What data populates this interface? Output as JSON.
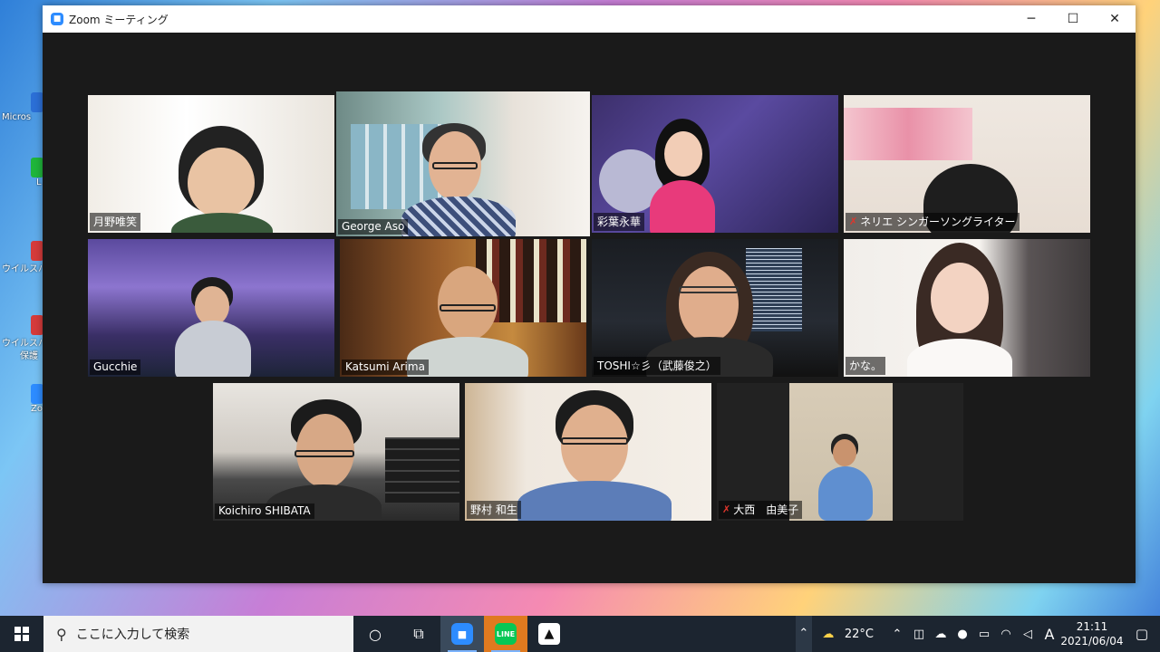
{
  "desktop": {
    "icons": [
      {
        "label": "Micros",
        "color": "#2b6fd6"
      },
      {
        "label": "L",
        "color": "#1fb53b"
      },
      {
        "label": "ウイルスバ",
        "color": "#d53b3b"
      },
      {
        "label": "ウイルスバ",
        "color": "#d53b3b"
      },
      {
        "label": "保護",
        "color": "#d53b3b"
      },
      {
        "label": "Zo",
        "color": "#2d8cff"
      }
    ]
  },
  "window": {
    "title": "Zoom ミーティング",
    "minimize": "─",
    "maximize": "☐",
    "close": "✕"
  },
  "participants": [
    {
      "name": "月野唯笑",
      "muted": false
    },
    {
      "name": "George Aso",
      "muted": false,
      "active_speaker": true
    },
    {
      "name": "彩葉永華",
      "muted": false
    },
    {
      "name": "ネリエ シンガーソングライター",
      "muted": true
    },
    {
      "name": "Gucchie",
      "muted": false
    },
    {
      "name": "Katsumi Arima",
      "muted": false
    },
    {
      "name": "TOSHI☆彡（武藤俊之）",
      "muted": false
    },
    {
      "name": "かな。",
      "muted": false
    },
    {
      "name": "Koichiro SHIBATA",
      "muted": false
    },
    {
      "name": "野村 和生",
      "muted": false
    },
    {
      "name": "大西　由美子",
      "muted": true
    }
  ],
  "taskbar": {
    "search_placeholder": "ここに入力して検索",
    "weather": "22°C",
    "ime": "A",
    "time": "21:11",
    "date": "2021/06/04",
    "colors": {
      "zoom": "#2d8cff",
      "line": "#06c755"
    }
  }
}
